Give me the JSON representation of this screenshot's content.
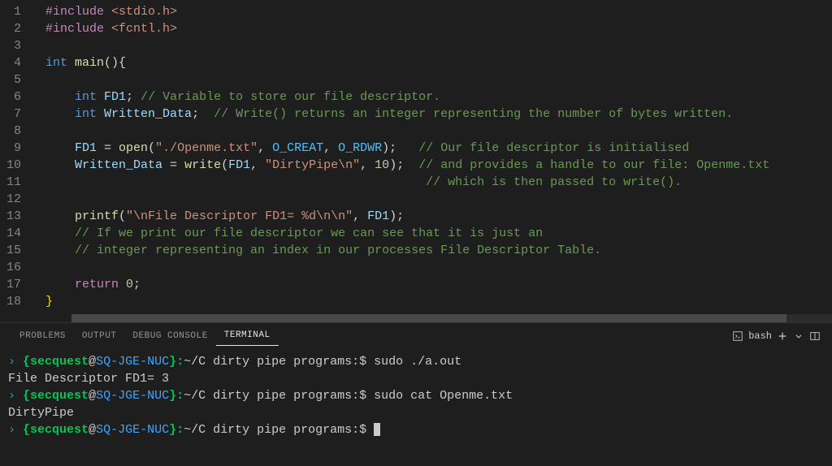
{
  "code": {
    "lines": [
      {
        "n": "1"
      },
      {
        "n": "2"
      },
      {
        "n": "3"
      },
      {
        "n": "4"
      },
      {
        "n": "5"
      },
      {
        "n": "6"
      },
      {
        "n": "7"
      },
      {
        "n": "8"
      },
      {
        "n": "9"
      },
      {
        "n": "10"
      },
      {
        "n": "11"
      },
      {
        "n": "12"
      },
      {
        "n": "13"
      },
      {
        "n": "14"
      },
      {
        "n": "15"
      },
      {
        "n": "16"
      },
      {
        "n": "17"
      },
      {
        "n": "18"
      }
    ],
    "tokens": {
      "include": "#include",
      "stdio": " <stdio.h>",
      "fcntl": " <fcntl.h>",
      "int": "int",
      "main": " main",
      "parens_open": "(){",
      "FD1": " FD1",
      "semicolon": ";",
      "comment_fd": " // Variable to store our file descriptor.",
      "WrittenData": " Written_Data",
      "comment_wd": "  // Write() returns an integer representing the number of bytes written.",
      "FD1_assign_lhs": "FD1",
      "equals": " = ",
      "open_fn": "open",
      "lparen": "(",
      "str_path": "\"./Openme.txt\"",
      "comma": ", ",
      "O_CREAT": "O_CREAT",
      "O_RDWR": "O_RDWR",
      "rparen_semi": ");",
      "comment_our": "   // Our file descriptor is initialised",
      "WD_lhs": "Written_Data",
      "write_fn": "write",
      "FD1_arg": "FD1",
      "str_dirty": "\"DirtyPipe\\n\"",
      "ten": "10",
      "comment_provides": "  // and provides a handle to our file: Openme.txt",
      "comment_which": "                                                    // which is then passed to write().",
      "printf": "printf",
      "str_printf": "\"\\nFile Descriptor FD1= %d\\n\\n\"",
      "FD1_p": "FD1",
      "comment_ifwe": "// If we print our file descriptor we can see that it is just an",
      "comment_integer": "// integer representing an index in our processes File Descriptor Table.",
      "return": "return",
      "zero": " 0",
      "brace_close": "}"
    }
  },
  "panel": {
    "tabs": {
      "problems": "PROBLEMS",
      "output": "OUTPUT",
      "debug": "DEBUG CONSOLE",
      "terminal": "TERMINAL"
    },
    "shell": "bash"
  },
  "terminal": {
    "user": "secquest",
    "at": "@",
    "host": "SQ-JGE-NUC",
    "path": "~/C dirty pipe programs",
    "dollar": ":$ ",
    "brace_open": " {",
    "brace_close": "}:",
    "cmd1": "sudo ./a.out",
    "blank": "",
    "out1": "File Descriptor FD1= 3",
    "cmd2": "sudo cat Openme.txt",
    "out2": "DirtyPipe"
  }
}
